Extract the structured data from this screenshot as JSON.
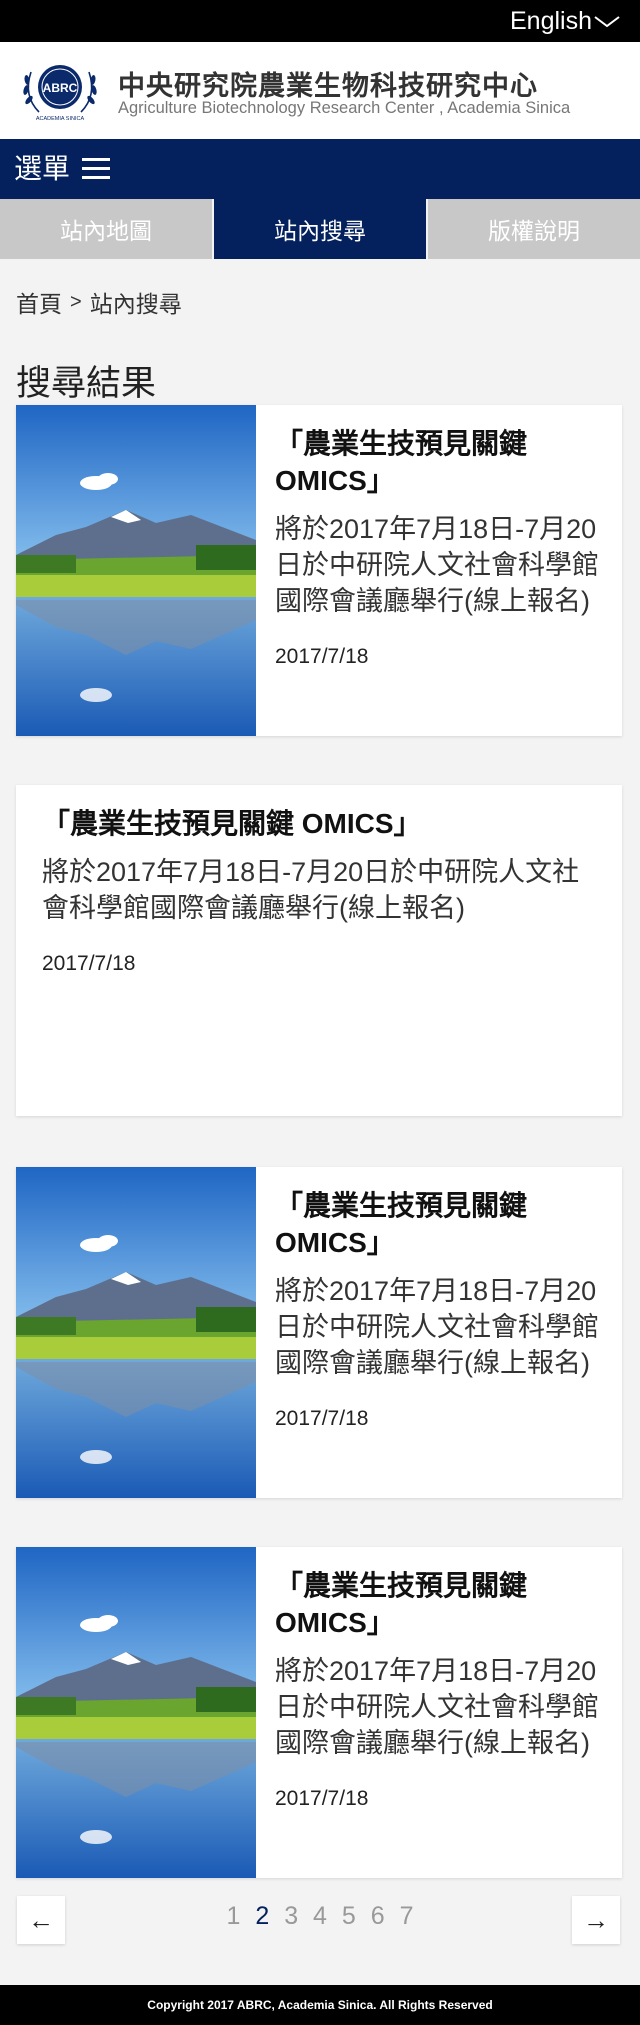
{
  "topbar": {
    "language": "English"
  },
  "header": {
    "site_name_zh": "中央研究院農業生物科技研究中心",
    "site_name_en": "Agriculture Biotechnology Research Center , Academia Sinica",
    "logo_text": "ABRC",
    "logo_subtext": "ACADEMIA SINICA"
  },
  "menu": {
    "label": "選單"
  },
  "tabs": [
    {
      "label": "站內地圖"
    },
    {
      "label": "站內搜尋"
    },
    {
      "label": "版權說明"
    }
  ],
  "breadcrumb": {
    "home": "首頁",
    "separator": ">",
    "current": "站內搜尋"
  },
  "page_title": "搜尋結果",
  "results": [
    {
      "title": "「農業生技預見關鍵 OMICS」",
      "desc": "將於2017年7月18日-7月20日於中研院人文社會科學館國際會議廳舉行(線上報名)",
      "date": "2017/7/18"
    },
    {
      "title": "「農業生技預見關鍵 OMICS」",
      "desc": "將於2017年7月18日-7月20日於中研院人文社會科學館國際會議廳舉行(線上報名)",
      "date": "2017/7/18"
    },
    {
      "title": "「農業生技預見關鍵 OMICS」",
      "desc": "將於2017年7月18日-7月20日於中研院人文社會科學館國際會議廳舉行(線上報名)",
      "date": "2017/7/18"
    },
    {
      "title": "「農業生技預見關鍵 OMICS」",
      "desc": "將於2017年7月18日-7月20日於中研院人文社會科學館國際會議廳舉行(線上報名)",
      "date": "2017/7/18"
    }
  ],
  "pagination": {
    "prev": "←",
    "next": "→",
    "pages": [
      "1",
      "2",
      "3",
      "4",
      "5",
      "6",
      "7"
    ],
    "current": "2"
  },
  "footer": {
    "copyright": "Copyright 2017 ABRC, Academia Sinica. All Rights Reserved"
  },
  "colors": {
    "brand_navy": "#04215e",
    "tab_inactive": "#c8c8c8",
    "background": "#f3f3f3"
  }
}
